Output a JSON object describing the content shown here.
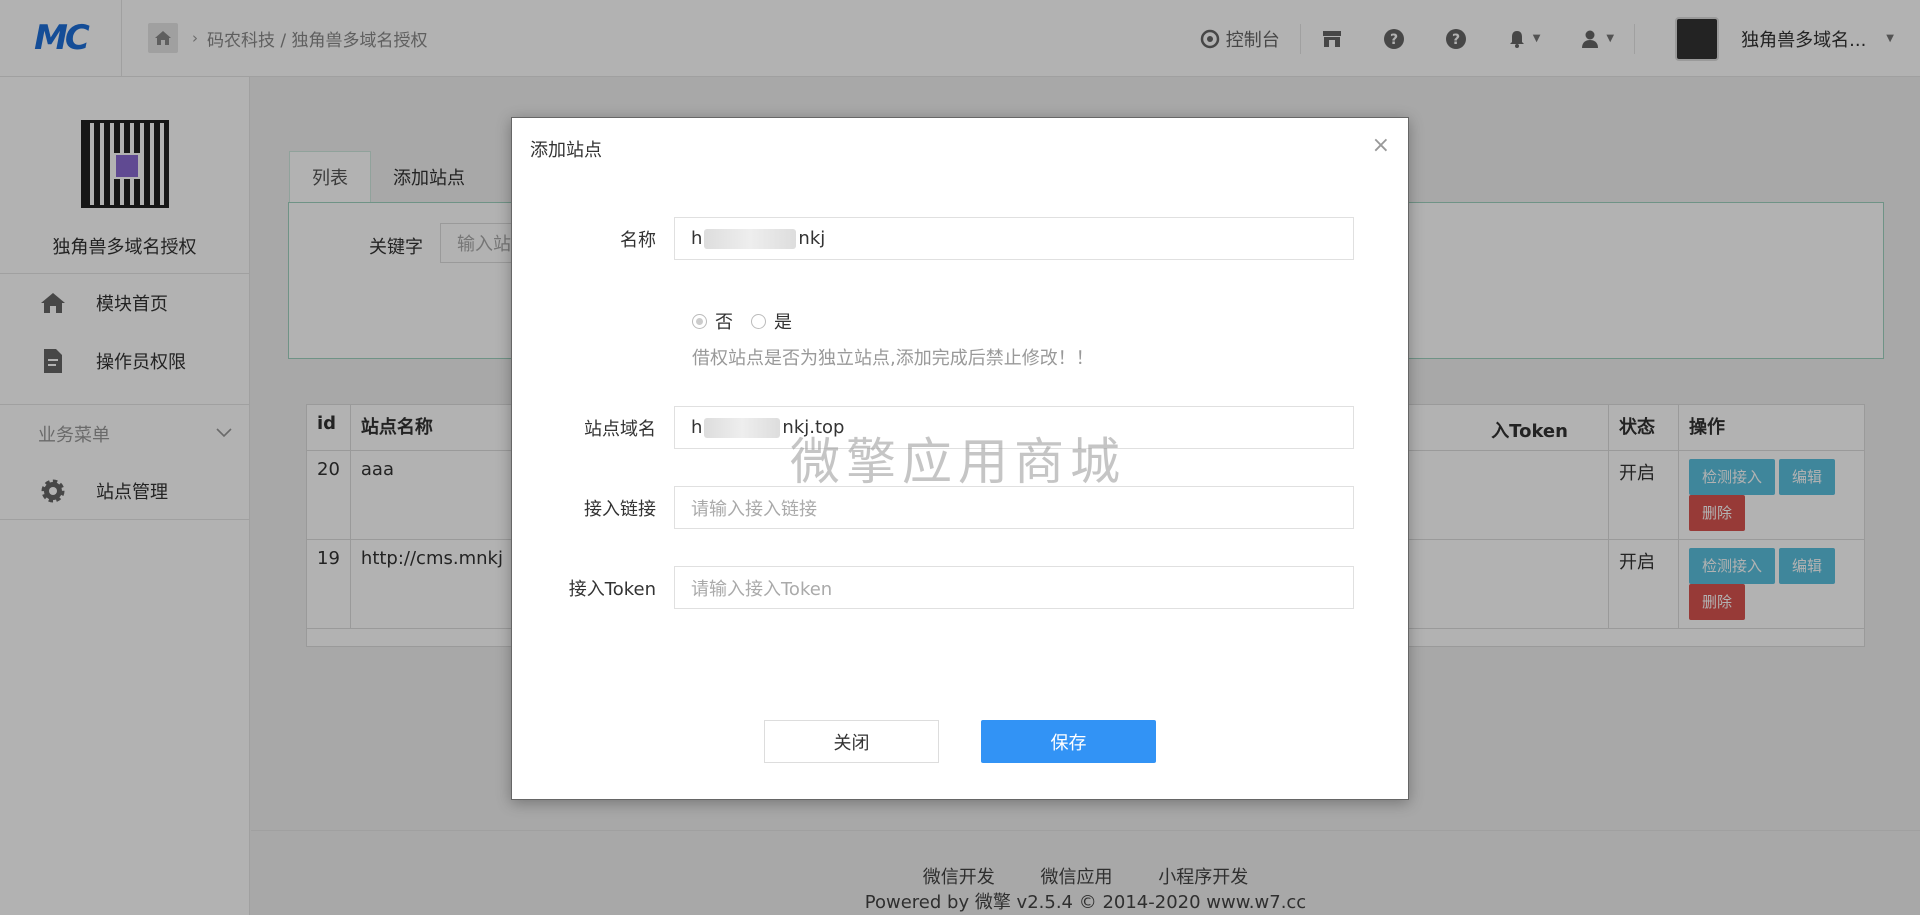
{
  "header": {
    "logo": "MC",
    "breadcrumb": "码农科技 / 独角兽多域名授权",
    "console": "控制台",
    "username": "独角兽多域名..."
  },
  "sidebar": {
    "site_name": "独角兽多域名授权",
    "items": [
      {
        "label": "模块首页",
        "icon": "home-icon"
      },
      {
        "label": "操作员权限",
        "icon": "document-icon"
      }
    ],
    "group_title": "业务菜单",
    "group_items": [
      {
        "label": "站点管理",
        "icon": "gear-icon"
      }
    ]
  },
  "main": {
    "tabs": [
      "列表",
      "添加站点"
    ],
    "keyword_label": "关键字",
    "keyword_placeholder": "输入站",
    "table": {
      "headers": [
        "id",
        "站点名称",
        "入Token",
        "状态",
        "操作"
      ],
      "rows": [
        {
          "id": "20",
          "name": "aaa",
          "status": "开启"
        },
        {
          "id": "19",
          "name": "http://cms.mnkj",
          "status": "开启"
        }
      ],
      "actions": {
        "check": "检测接入",
        "edit": "编辑",
        "delete": "删除"
      }
    }
  },
  "footer": {
    "links": [
      "微信开发",
      "微信应用",
      "小程序开发"
    ],
    "powered": "Powered by 微擎 v2.5.4 © 2014-2020 www.w7.cc"
  },
  "modal": {
    "title": "添加站点",
    "close_symbol": "×",
    "name_label": "名称",
    "name_prefix": "h",
    "name_suffix": "nkj",
    "radio_no": "否",
    "radio_yes": "是",
    "hint": "借权站点是否为独立站点,添加完成后禁止修改！！",
    "domain_label": "站点域名",
    "domain_prefix": "h",
    "domain_suffix": "nkj.top",
    "link_label": "接入链接",
    "link_placeholder": "请输入接入链接",
    "token_label": "接入Token",
    "token_placeholder": "请输入接入Token",
    "close_button": "关闭",
    "save_button": "保存"
  },
  "watermark": "微擎应用商城"
}
